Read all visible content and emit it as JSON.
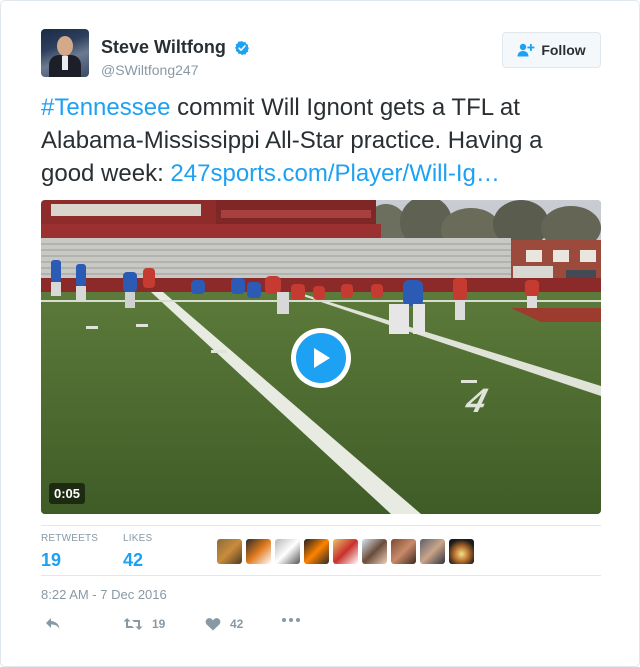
{
  "user": {
    "display_name": "Steve Wiltfong",
    "handle": "@SWiltfong247",
    "verified": true,
    "avatar_icon": "profile-photo"
  },
  "follow_button": {
    "label": "Follow",
    "icon": "follow-person-plus-icon"
  },
  "tweet": {
    "hashtag": "#Tennessee",
    "text_part1": " commit Will Ignont gets a TFL at Alabama-Mississippi All-Star practice. Having a good week: ",
    "link_text": "247sports.com/Player/Will-Ig…"
  },
  "media": {
    "duration": "0:05",
    "play_icon": "play-icon"
  },
  "stats": {
    "retweets_label": "RETWEETS",
    "retweets_value": "19",
    "likes_label": "LIKES",
    "likes_value": "42"
  },
  "timestamp": "8:22 AM - 7 Dec 2016",
  "actions": {
    "reply_icon": "reply-icon",
    "retweet_icon": "retweet-icon",
    "retweet_count": "19",
    "like_icon": "heart-icon",
    "like_count": "42",
    "more_icon": "more-icon"
  },
  "colors": {
    "accent": "#1da1f2",
    "text": "#292f33",
    "muted": "#8899a6",
    "border": "#e1e8ed"
  }
}
